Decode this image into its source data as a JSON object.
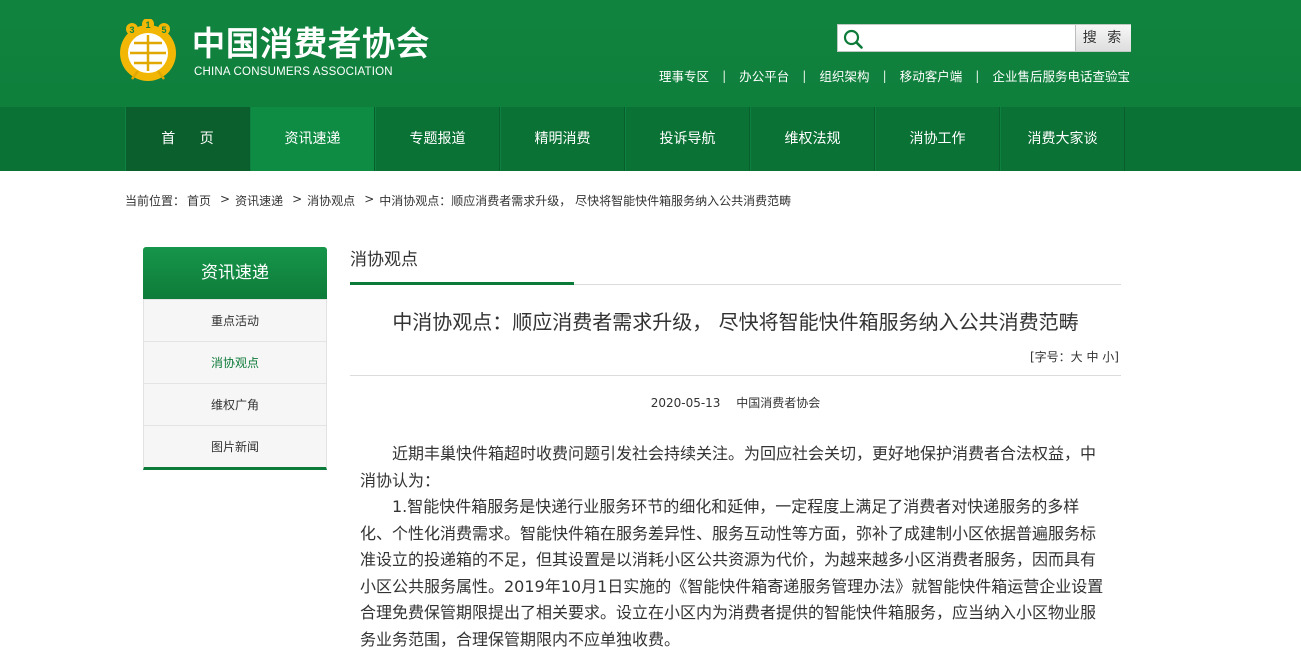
{
  "header": {
    "logo_cn": "中国消费者协会",
    "logo_en": "CHINA CONSUMERS ASSOCIATION",
    "search": {
      "placeholder": "",
      "button_label": "搜 索"
    },
    "toplinks": [
      "理事专区",
      "办公平台",
      "组织架构",
      "移动客户端",
      "企业售后服务电话查验宝"
    ]
  },
  "nav": {
    "items": [
      "首 页",
      "资讯速递",
      "专题报道",
      "精明消费",
      "投诉导航",
      "维权法规",
      "消协工作",
      "消费大家谈"
    ]
  },
  "breadcrumb": {
    "prefix": "当前位置：",
    "items": [
      "首页",
      "资讯速递",
      "消协观点",
      "中消协观点：顺应消费者需求升级， 尽快将智能快件箱服务纳入公共消费范畴"
    ]
  },
  "sidebar": {
    "title": "资讯速递",
    "items": [
      "重点活动",
      "消协观点",
      "维权广角",
      "图片新闻"
    ]
  },
  "main": {
    "section_title": "消协观点",
    "article_title": "中消协观点：顺应消费者需求升级， 尽快将智能快件箱服务纳入公共消费范畴",
    "font_size_label": "[字号：大 中 小]",
    "date": "2020-05-13",
    "source": "中国消费者协会",
    "paragraphs": [
      "近期丰巢快件箱超时收费问题引发社会持续关注。为回应社会关切，更好地保护消费者合法权益，中消协认为：",
      "1.智能快件箱服务是快递行业服务环节的细化和延伸，一定程度上满足了消费者对快递服务的多样化、个性化消费需求。智能快件箱在服务差异性、服务互动性等方面，弥补了成建制小区依据普遍服务标准设立的投递箱的不足，但其设置是以消耗小区公共资源为代价，为越来越多小区消费者服务，因而具有小区公共服务属性。2019年10月1日实施的《智能快件箱寄递服务管理办法》就智能快件箱运营企业设置合理免费保管期限提出了相关要求。设立在小区内为消费者提供的智能快件箱服务，应当纳入小区物业服务业务范围，合理保管期限内不应单独收费。"
    ]
  },
  "colors": {
    "brand_green": "#10843f",
    "nav_green": "#0b7236",
    "emblem_gold": "#f2b705"
  }
}
